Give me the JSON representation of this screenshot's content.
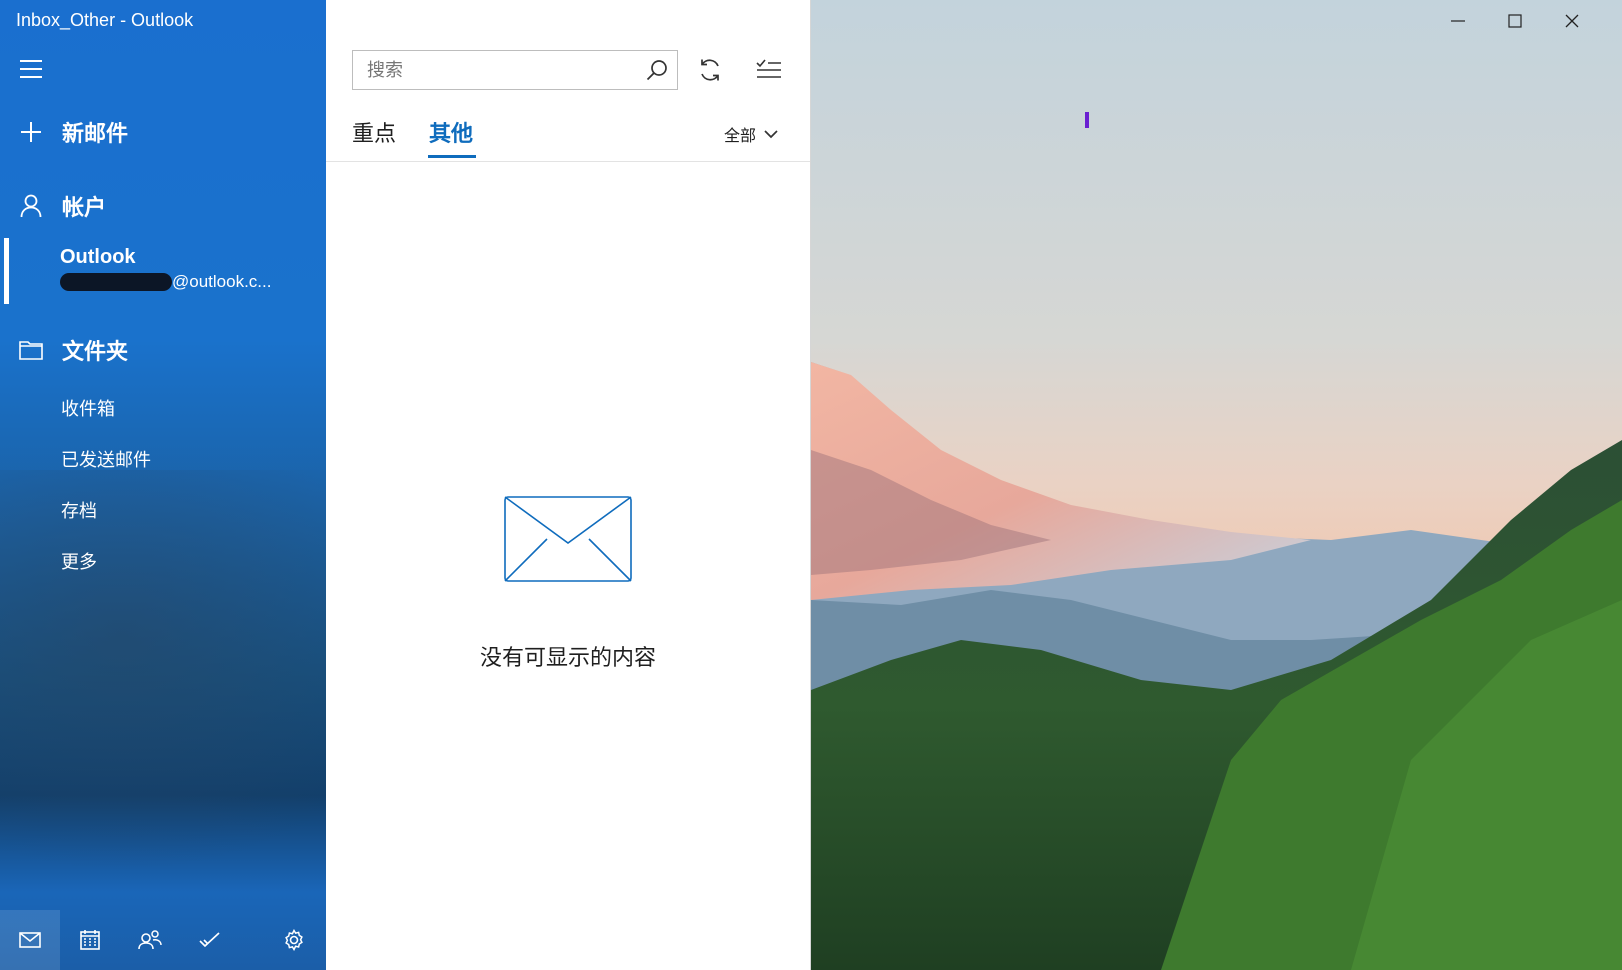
{
  "window": {
    "title": "Inbox_Other - Outlook"
  },
  "sidebar": {
    "new_mail": "新邮件",
    "accounts_header": "帐户",
    "account": {
      "name": "Outlook",
      "email_suffix": "@outlook.c..."
    },
    "folders_header": "文件夹",
    "folders": [
      "收件箱",
      "已发送邮件",
      "存档",
      "更多"
    ],
    "bottom_nav": [
      "mail-icon",
      "calendar-icon",
      "people-icon",
      "todo-icon",
      "settings-icon"
    ]
  },
  "mail_list": {
    "search_placeholder": "搜索",
    "tabs": {
      "focused": "重点",
      "other": "其他",
      "active": "其他"
    },
    "filter_label": "全部",
    "empty_message": "没有可显示的内容"
  },
  "colors": {
    "accent": "#0f6cbd",
    "sidebar": "#1a6fcf"
  }
}
